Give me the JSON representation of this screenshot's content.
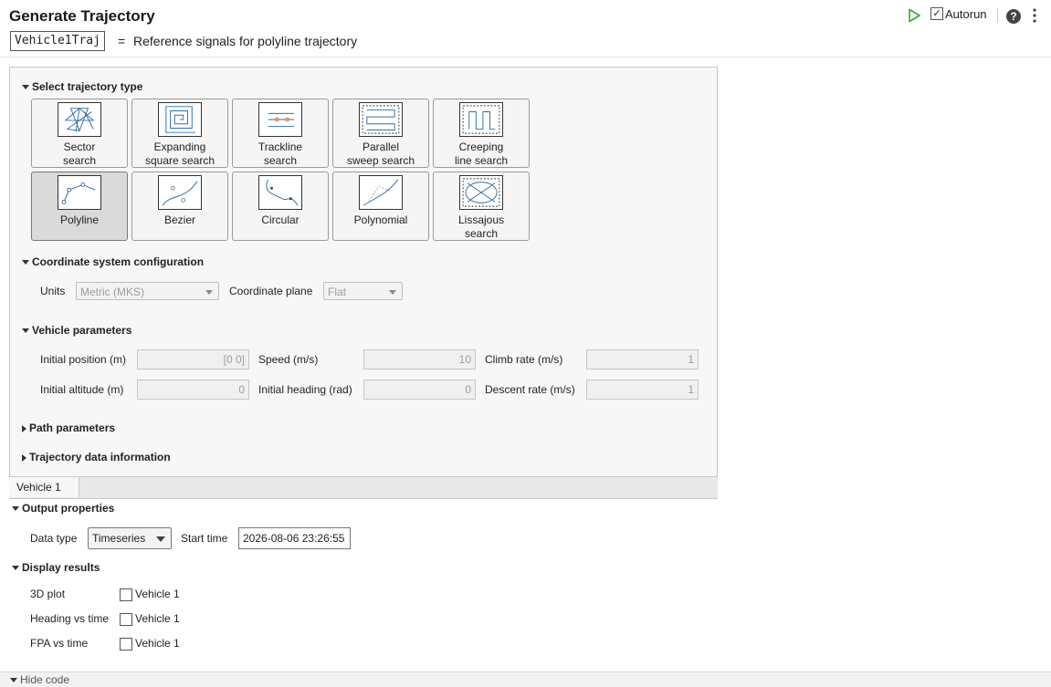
{
  "header": {
    "title": "Generate Trajectory",
    "variable": "Vehicle1Traj",
    "equals": "=",
    "description": "Reference signals for polyline trajectory",
    "autorun_label": "Autorun",
    "autorun_checked": true,
    "help_glyph": "?"
  },
  "trajectory_type": {
    "heading": "Select trajectory type",
    "selected": "Polyline",
    "tiles": [
      {
        "line1": "Sector",
        "line2": "search",
        "icon": "sector-search-icon"
      },
      {
        "line1": "Expanding",
        "line2": "square search",
        "icon": "expanding-square-search-icon"
      },
      {
        "line1": "Trackline",
        "line2": "search",
        "icon": "trackline-search-icon"
      },
      {
        "line1": "Parallel",
        "line2": "sweep search",
        "icon": "parallel-sweep-search-icon"
      },
      {
        "line1": "Creeping",
        "line2": "line search",
        "icon": "creeping-line-search-icon"
      },
      {
        "line1": "Polyline",
        "line2": "",
        "icon": "polyline-icon"
      },
      {
        "line1": "Bezier",
        "line2": "",
        "icon": "bezier-icon"
      },
      {
        "line1": "Circular",
        "line2": "",
        "icon": "circular-icon"
      },
      {
        "line1": "Polynomial",
        "line2": "",
        "icon": "polynomial-icon"
      },
      {
        "line1": "Lissajous",
        "line2": "search",
        "icon": "lissajous-search-icon"
      }
    ]
  },
  "coordinate": {
    "heading": "Coordinate system configuration",
    "units_label": "Units",
    "units_value": "Metric (MKS)",
    "plane_label": "Coordinate plane",
    "plane_value": "Flat"
  },
  "vehicle": {
    "heading": "Vehicle parameters",
    "initial_position_label": "Initial position (m)",
    "initial_position_value": "[0 0]",
    "speed_label": "Speed (m/s)",
    "speed_value": "10",
    "climb_label": "Climb rate (m/s)",
    "climb_value": "1",
    "initial_altitude_label": "Initial altitude (m)",
    "initial_altitude_value": "0",
    "initial_heading_label": "Initial heading (rad)",
    "initial_heading_value": "0",
    "descent_label": "Descent rate (m/s)",
    "descent_value": "1"
  },
  "path": {
    "heading": "Path parameters"
  },
  "traj_info": {
    "heading": "Trajectory data information"
  },
  "tabs": [
    {
      "label": "Vehicle 1"
    }
  ],
  "output": {
    "heading": "Output properties",
    "data_type_label": "Data type",
    "data_type_value": "Timeseries",
    "start_time_label": "Start time",
    "start_time_value": "2026-08-06 23:26:55"
  },
  "display": {
    "heading": "Display results",
    "rows": [
      {
        "label": "3D plot",
        "option": "Vehicle 1",
        "checked": false
      },
      {
        "label": "Heading vs time",
        "option": "Vehicle 1",
        "checked": false
      },
      {
        "label": "FPA vs time",
        "option": "Vehicle 1",
        "checked": false
      }
    ]
  },
  "footer": {
    "hide_code_label": "Hide code"
  },
  "colors": {
    "accent_run": "#2dae2d",
    "panel_bg": "#f7f7f7",
    "selected_tile": "#dadada"
  }
}
